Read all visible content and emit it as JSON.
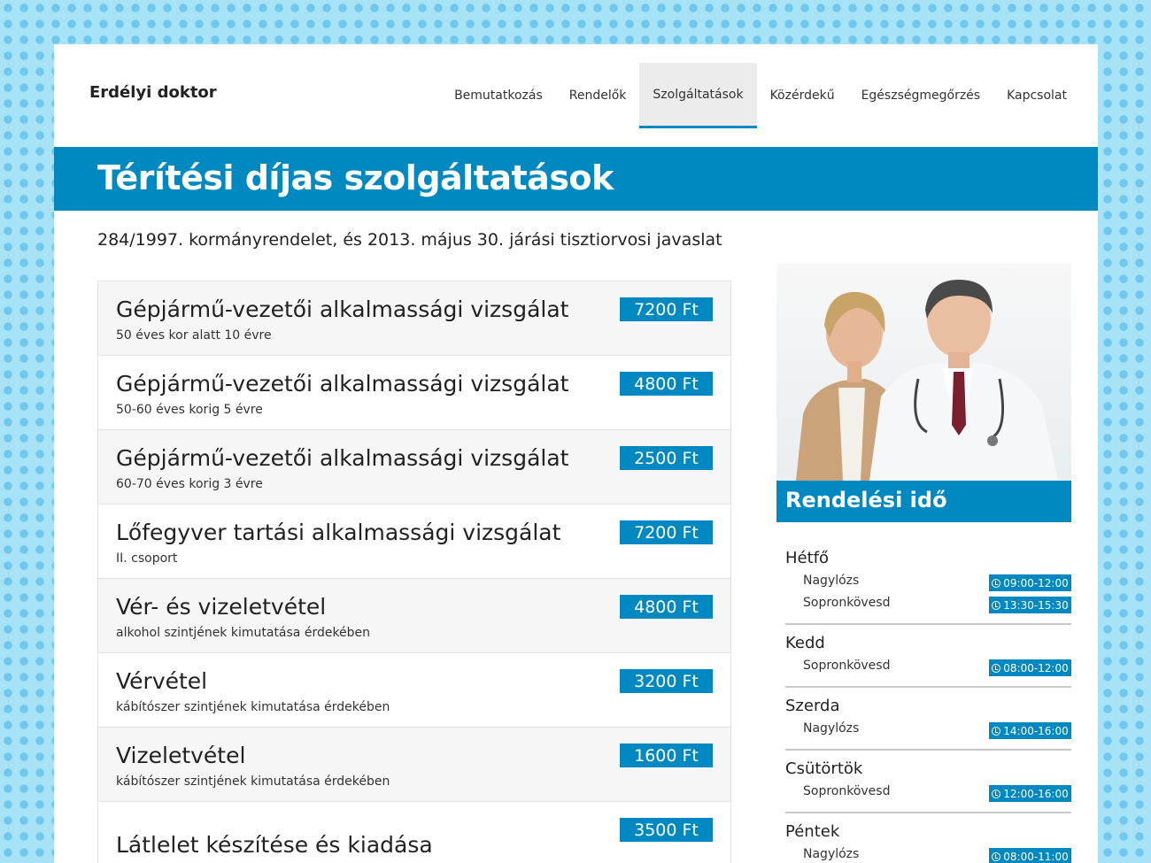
{
  "header": {
    "brand": "Erdélyi doktor",
    "nav": [
      "Bemutatkozás",
      "Rendelők",
      "Szolgáltatások",
      "Közérdekű",
      "Egészségmegőrzés",
      "Kapcsolat"
    ],
    "active_nav": "Szolgáltatások"
  },
  "page": {
    "title": "Térítési díjas szolgáltatások",
    "subtitle": "284/1997. kormányrendelet, és 2013. május 30. járási tisztiorvosi javaslat"
  },
  "services": [
    {
      "name": "Gépjármű-vezetői alkalmassági vizsgálat",
      "note": "50 éves kor alatt 10 évre",
      "price": "7200 Ft"
    },
    {
      "name": "Gépjármű-vezetői alkalmassági vizsgálat",
      "note": "50-60 éves korig 5 évre",
      "price": "4800 Ft"
    },
    {
      "name": "Gépjármű-vezetői alkalmassági vizsgálat",
      "note": "60-70 éves korig 3 évre",
      "price": "2500 Ft"
    },
    {
      "name": "Lőfegyver tartási alkalmassági vizsgálat",
      "note": "II. csoport",
      "price": "7200 Ft"
    },
    {
      "name": "Vér- és vizeletvétel",
      "note": "alkohol szintjének kimutatása érdekében",
      "price": "4800 Ft"
    },
    {
      "name": "Vérvétel",
      "note": "kábítószer szintjének kimutatása érdekében",
      "price": "3200 Ft"
    },
    {
      "name": "Vizeletvétel",
      "note": "kábítószer szintjének kimutatása érdekében",
      "price": "1600 Ft"
    },
    {
      "name": "Látlelet készítése és kiadása",
      "note": "",
      "price": "3500 Ft"
    }
  ],
  "sidebar": {
    "hours_title": "Rendelési idő",
    "days": [
      {
        "day": "Hétfő",
        "slots": [
          {
            "place": "Nagylózs",
            "time": "09:00-12:00"
          },
          {
            "place": "Sopronkövesd",
            "time": "13:30-15:30"
          }
        ]
      },
      {
        "day": "Kedd",
        "slots": [
          {
            "place": "Sopronkövesd",
            "time": "08:00-12:00"
          }
        ]
      },
      {
        "day": "Szerda",
        "slots": [
          {
            "place": "Nagylózs",
            "time": "14:00-16:00"
          }
        ]
      },
      {
        "day": "Csütörtök",
        "slots": [
          {
            "place": "Sopronkövesd",
            "time": "12:00-16:00"
          }
        ]
      },
      {
        "day": "Péntek",
        "slots": [
          {
            "place": "Nagylózs",
            "time": "08:00-11:00"
          }
        ]
      }
    ]
  },
  "colors": {
    "accent": "#0089c0",
    "background": "#a8e2f6"
  }
}
